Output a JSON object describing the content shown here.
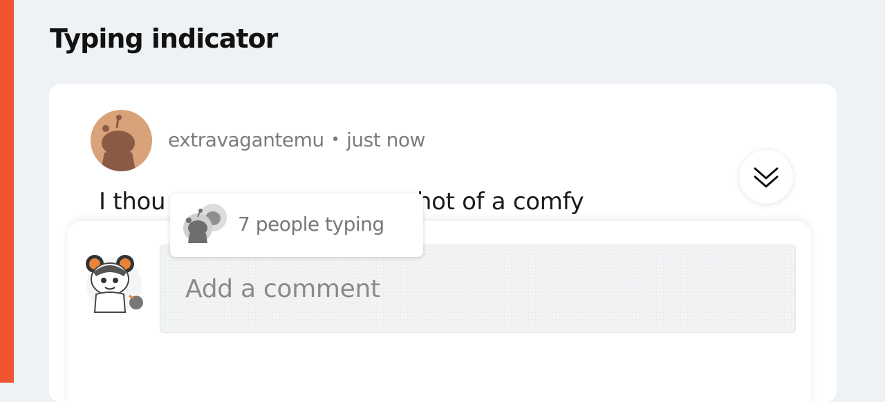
{
  "page": {
    "title": "Typing indicator"
  },
  "comment": {
    "author": "extravagantemu",
    "separator": "•",
    "timestamp": "just now",
    "body_start": "I thou",
    "body_end": "e up shot of a comfy",
    "author_avatar_icon": "snoo-avatar-icon"
  },
  "scroll_button": {
    "icon": "double-chevron-down-icon"
  },
  "typing_indicator": {
    "text": "7 people typing",
    "icon": "snoo-avatar-stack-icon"
  },
  "composer": {
    "placeholder": "Add a comment",
    "user_avatar_icon": "user-avatar-icon"
  },
  "colors": {
    "accent": "#ee5530",
    "background": "#eff2f5",
    "card": "#ffffff",
    "muted_text": "#7c7c7c"
  }
}
